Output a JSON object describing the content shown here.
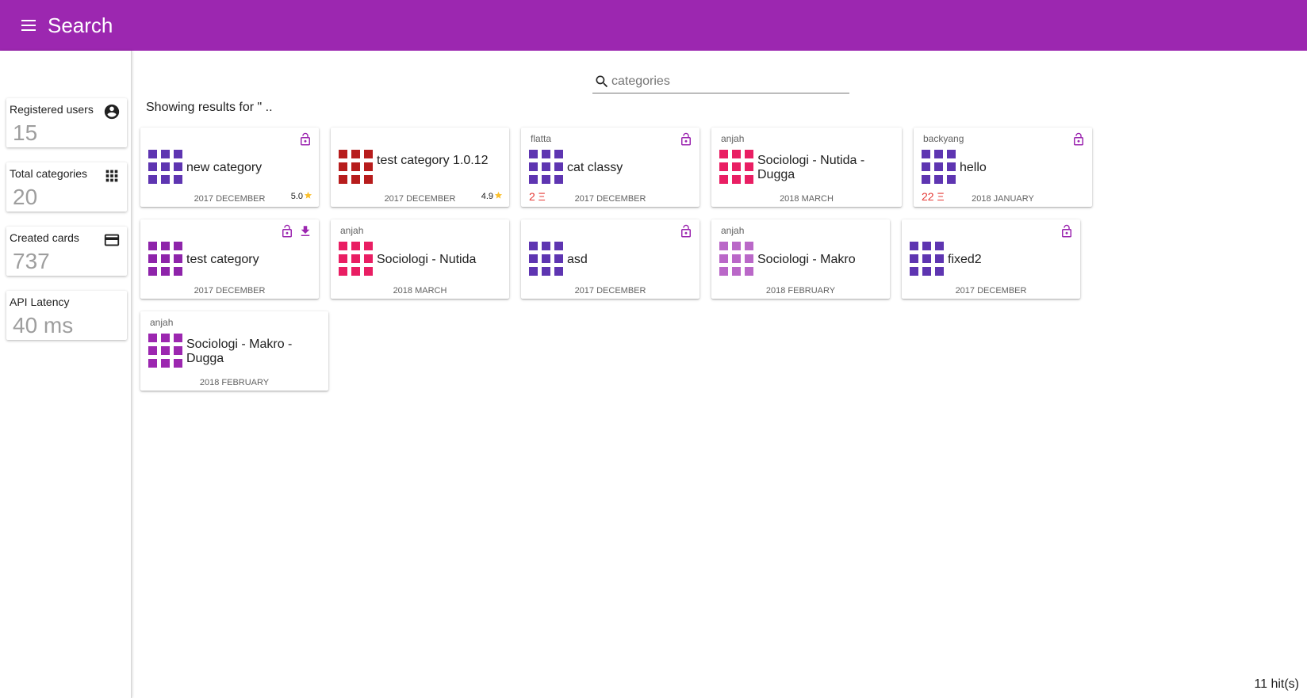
{
  "app": {
    "title": "Search"
  },
  "stats": [
    {
      "label": "Registered users",
      "value": "15",
      "icon": "account-circle-icon"
    },
    {
      "label": "Total categories",
      "value": "20",
      "icon": "apps-grid-icon"
    },
    {
      "label": "Created cards",
      "value": "737",
      "icon": "credit-card-icon"
    },
    {
      "label": "API Latency",
      "value": "40 ms",
      "icon": ""
    }
  ],
  "search": {
    "placeholder": "categories",
    "value": ""
  },
  "results_text": "Showing results for \" ..",
  "cards": [
    {
      "name": "new category",
      "author": "",
      "date": "2017 DECEMBER",
      "rating": "5.0",
      "count": "",
      "color": "#5e35b1",
      "locked": true,
      "download": false
    },
    {
      "name": "test category 1.0.12",
      "author": "",
      "date": "2017 DECEMBER",
      "rating": "4.9",
      "count": "",
      "color": "#b71c1c",
      "locked": false,
      "download": false
    },
    {
      "name": "cat classy",
      "author": "flatta",
      "date": "2017 DECEMBER",
      "rating": "",
      "count": "2 Ξ",
      "color": "#5e35b1",
      "locked": true,
      "download": false
    },
    {
      "name": "Sociologi - Nutida - Dugga",
      "author": "anjah",
      "date": "2018 MARCH",
      "rating": "",
      "count": "",
      "color": "#e91e63",
      "locked": false,
      "download": false
    },
    {
      "name": "hello",
      "author": "backyang",
      "date": "2018 JANUARY",
      "rating": "",
      "count": "22 Ξ",
      "color": "#5e35b1",
      "locked": true,
      "download": false
    },
    {
      "name": "test category",
      "author": "",
      "date": "2017 DECEMBER",
      "rating": "",
      "count": "",
      "color": "#8e24aa",
      "locked": true,
      "download": true
    },
    {
      "name": "Sociologi - Nutida",
      "author": "anjah",
      "date": "2018 MARCH",
      "rating": "",
      "count": "",
      "color": "#e91e63",
      "locked": false,
      "download": false
    },
    {
      "name": "asd",
      "author": "",
      "date": "2017 DECEMBER",
      "rating": "",
      "count": "",
      "color": "#5e35b1",
      "locked": true,
      "download": false
    },
    {
      "name": "Sociologi - Makro",
      "author": "anjah",
      "date": "2018 FEBRUARY",
      "rating": "",
      "count": "",
      "color": "#ba68c8",
      "locked": false,
      "download": false
    },
    {
      "name": "fixed2",
      "author": "",
      "date": "2017 DECEMBER",
      "rating": "",
      "count": "",
      "color": "#5e35b1",
      "locked": true,
      "download": false
    },
    {
      "name": "Sociologi - Makro - Dugga",
      "author": "anjah",
      "date": "2018 FEBRUARY",
      "rating": "",
      "count": "",
      "color": "#9c27b0",
      "locked": false,
      "download": false
    }
  ],
  "hits": "11 hit(s)",
  "colors": {
    "primary": "#9c27b0",
    "star": "#fbc02d",
    "lock": "#9c27b0",
    "count": "#e53935"
  }
}
